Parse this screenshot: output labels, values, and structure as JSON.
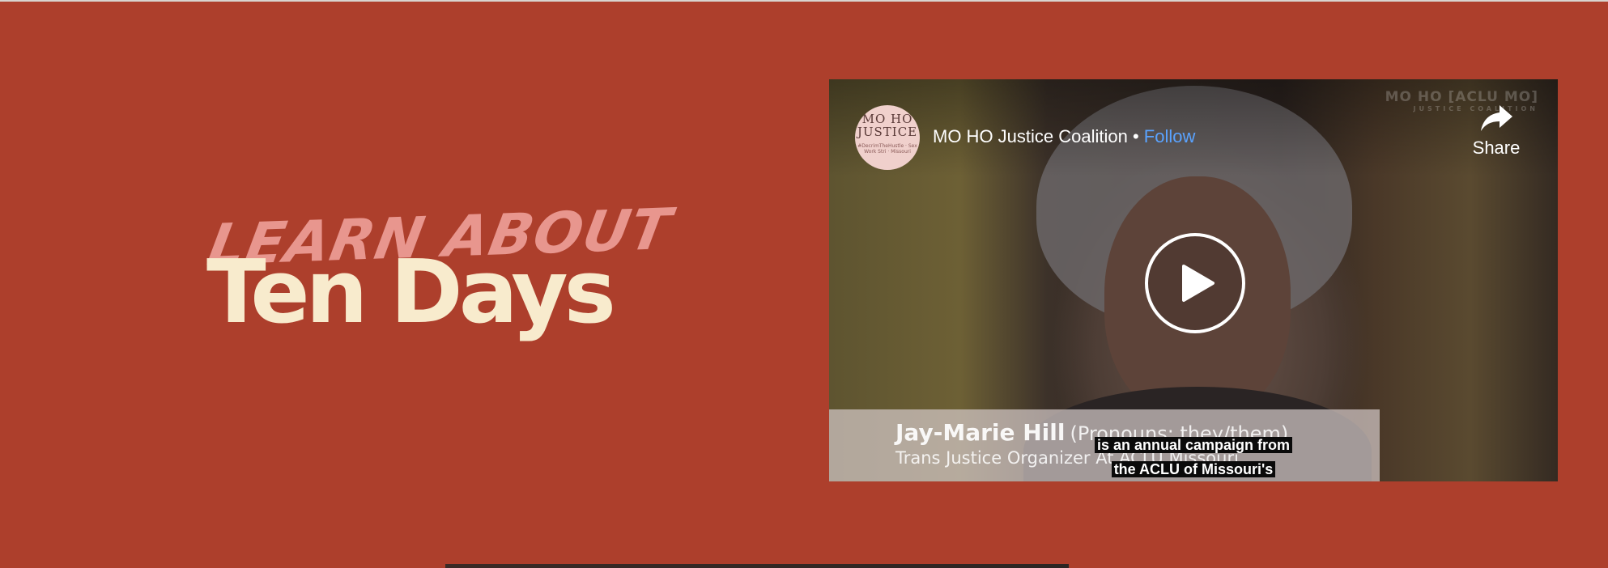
{
  "heading": {
    "kicker": "LEARN ABOUT",
    "title": "Ten Days"
  },
  "video": {
    "channel": {
      "avatar_line1": "MO HO",
      "avatar_line2": "JUSTICE",
      "avatar_small": "#DecrimTheHustle · Sex Work Stri · Missouri",
      "name": "MO HO Justice Coalition",
      "separator": " • ",
      "follow_label": "Follow"
    },
    "share_label": "Share",
    "share_icon": "share-arrow-icon",
    "play_icon": "play-icon",
    "watermark": {
      "line1": "MO HO [ACLU MO]",
      "line2": "JUSTICE COALITION"
    },
    "lower_third": {
      "name": "Jay-Marie Hill",
      "pronouns": "(Pronouns: they/them)",
      "role": "Trans Justice Organizer At ACLU Missouri"
    },
    "captions": [
      "is an annual campaign from",
      "the ACLU of Missouri's"
    ]
  },
  "colors": {
    "background": "#ad3f2c",
    "kicker": "#e8968e",
    "title": "#f8ebcd",
    "follow_link": "#5aa3ff"
  }
}
